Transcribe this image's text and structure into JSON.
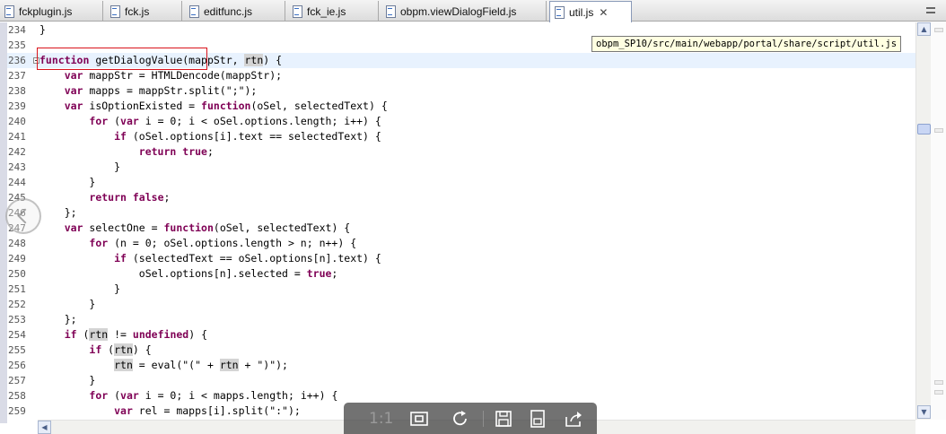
{
  "tabs": [
    {
      "label": "fckplugin.js",
      "active": false
    },
    {
      "label": "fck.js",
      "active": false
    },
    {
      "label": "editfunc.js",
      "active": false
    },
    {
      "label": "fck_ie.js",
      "active": false
    },
    {
      "label": "obpm.viewDialogField.js",
      "active": false
    },
    {
      "label": "util.js",
      "active": true
    }
  ],
  "tab_close_glyph": "✕",
  "tooltip": "obpm_SP10/src/main/webapp/portal/share/script/util.js",
  "current_line": "236",
  "lines": [
    {
      "n": "234",
      "code": "}"
    },
    {
      "n": "235",
      "code": ""
    },
    {
      "n": "236",
      "code": "function getDialogValue(mappStr, rtn) {"
    },
    {
      "n": "237",
      "code": "    var mappStr = HTMLDencode(mappStr);"
    },
    {
      "n": "238",
      "code": "    var mapps = mappStr.split(\";\");"
    },
    {
      "n": "239",
      "code": "    var isOptionExisted = function(oSel, selectedText) {"
    },
    {
      "n": "240",
      "code": "        for (var i = 0; i < oSel.options.length; i++) {"
    },
    {
      "n": "241",
      "code": "            if (oSel.options[i].text == selectedText) {"
    },
    {
      "n": "242",
      "code": "                return true;"
    },
    {
      "n": "243",
      "code": "            }"
    },
    {
      "n": "244",
      "code": "        }"
    },
    {
      "n": "245",
      "code": "        return false;"
    },
    {
      "n": "246",
      "code": "    };"
    },
    {
      "n": "247",
      "code": "    var selectOne = function(oSel, selectedText) {"
    },
    {
      "n": "248",
      "code": "        for (n = 0; oSel.options.length > n; n++) {"
    },
    {
      "n": "249",
      "code": "            if (selectedText == oSel.options[n].text) {"
    },
    {
      "n": "250",
      "code": "                oSel.options[n].selected = true;"
    },
    {
      "n": "251",
      "code": "            }"
    },
    {
      "n": "252",
      "code": "        }"
    },
    {
      "n": "253",
      "code": "    };"
    },
    {
      "n": "254",
      "code": "    if (rtn != undefined) {"
    },
    {
      "n": "255",
      "code": "        if (rtn) {"
    },
    {
      "n": "256",
      "code": "            rtn = eval(\"(\" + rtn + \")\");"
    },
    {
      "n": "257",
      "code": "        }"
    },
    {
      "n": "258",
      "code": "        for (var i = 0; i < mapps.length; i++) {"
    },
    {
      "n": "259",
      "code": "            var rel = mapps[i].split(\":\");"
    }
  ],
  "keywords": [
    "function",
    "var",
    "for",
    "if",
    "return",
    "true",
    "false",
    "undefined"
  ],
  "highlight_word": "rtn",
  "viewer_toolbar": {
    "actual_size": "1:1",
    "buttons": [
      "fit-screen",
      "rotate",
      "save",
      "print",
      "share"
    ]
  },
  "colors": {
    "keyword": "#7f0055",
    "current_line_bg": "#e8f2fe",
    "occurrence_bg": "#d4d4d4",
    "red_box": "#d9141c",
    "tooltip_bg": "#ffffe1"
  }
}
